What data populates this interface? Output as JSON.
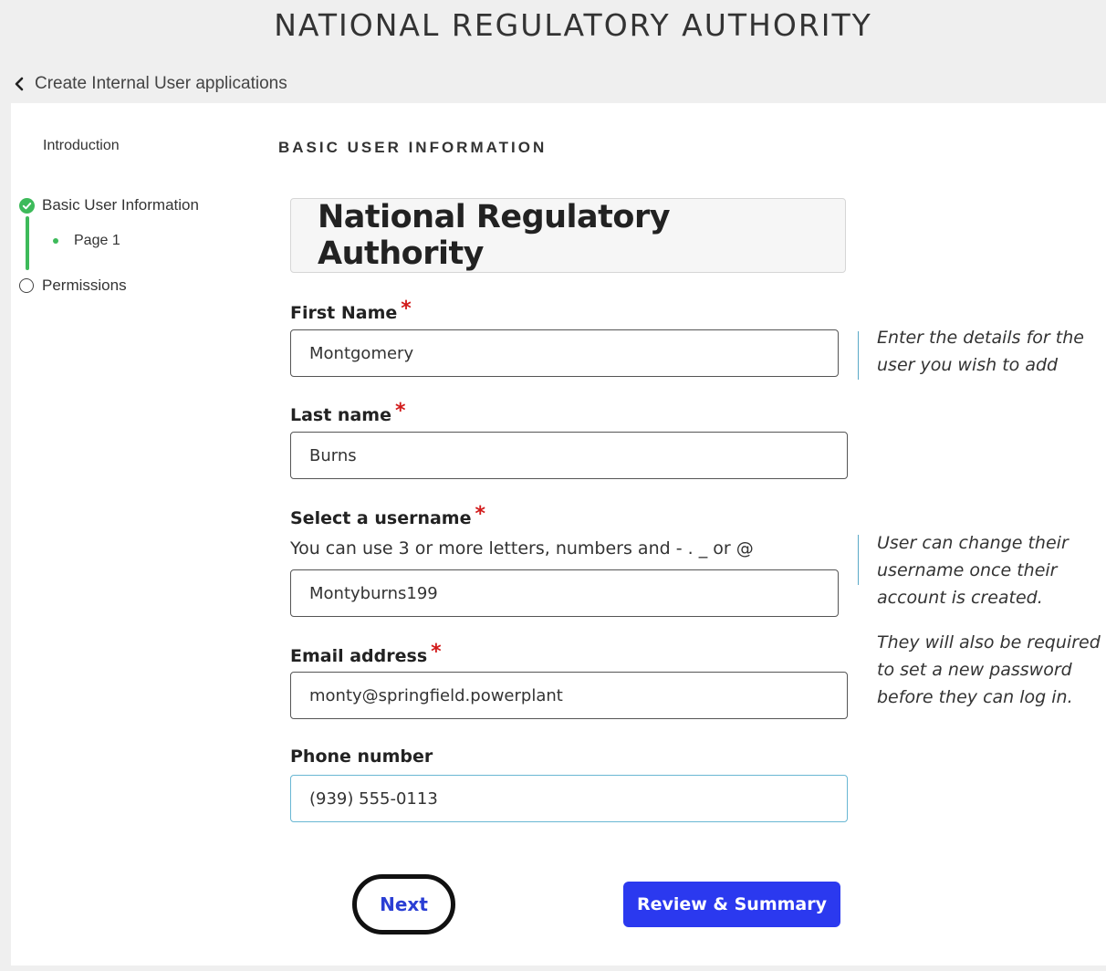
{
  "app": {
    "title": "NATIONAL REGULATORY AUTHORITY"
  },
  "nav": {
    "back_label": "Create Internal User applications"
  },
  "sidebar": {
    "intro_label": "Introduction",
    "steps": [
      {
        "label": "Basic User Information",
        "status": "complete",
        "icon": "check-circle-icon"
      },
      {
        "label": "Page 1",
        "status": "current",
        "icon": "dot-icon"
      },
      {
        "label": "Permissions",
        "status": "incomplete",
        "icon": "empty-circle-icon"
      }
    ]
  },
  "main": {
    "section_title": "BASIC USER INFORMATION",
    "org_name": "National Regulatory Authority",
    "fields": {
      "first_name": {
        "label": "First Name",
        "required": "*",
        "value": "Montgomery"
      },
      "last_name": {
        "label": "Last name",
        "required": "*",
        "value": "Burns"
      },
      "username": {
        "label": "Select a username",
        "required": "*",
        "hint": "You can use 3 or more letters, numbers and - . _ or @",
        "value": "Montyburns199"
      },
      "email": {
        "label": "Email address",
        "required": "*",
        "value": "monty@springfield.powerplant"
      },
      "phone": {
        "label": "Phone number",
        "value": "(939) 555-0113"
      }
    },
    "help": {
      "details": [
        "Enter the details for the",
        "user you wish to add"
      ],
      "username": [
        "User can change their",
        "username once their",
        "account is created."
      ],
      "password": [
        "They will also be required",
        "to set a new password",
        "before they can log in."
      ]
    },
    "buttons": {
      "next": "Next",
      "review": "Review & Summary"
    }
  },
  "colors": {
    "accent": "#2b39ef",
    "success": "#3dba5a",
    "required": "#d21b1b",
    "focus": "#69b7d3"
  }
}
